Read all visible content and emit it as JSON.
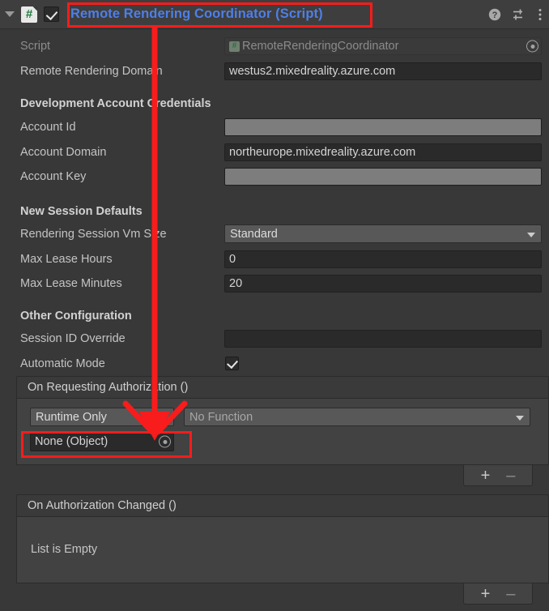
{
  "header": {
    "title": "Remote Rendering Coordinator (Script)",
    "title_color": "#4e7fe8",
    "script_icon": "csharp-script-icon",
    "enabled": true,
    "foldout_expanded": true,
    "icons": [
      {
        "name": "help-icon",
        "glyph": "?"
      },
      {
        "name": "preset-icon",
        "glyph": "sliders"
      },
      {
        "name": "more-menu-icon",
        "glyph": "kebab"
      }
    ]
  },
  "fields": {
    "script": {
      "label": "Script",
      "value": "RemoteRenderingCoordinator",
      "disabled": true,
      "has_object_picker": true
    },
    "remote_rendering_domain": {
      "label": "Remote Rendering Domain",
      "value": "westus2.mixedreality.azure.com"
    }
  },
  "sections": [
    {
      "heading": "Development Account Credentials",
      "rows": [
        {
          "label": "Account Id",
          "value": "",
          "redacted": true
        },
        {
          "label": "Account Domain",
          "value": "northeurope.mixedreality.azure.com",
          "redacted": false
        },
        {
          "label": "Account Key",
          "value": "",
          "redacted": true
        }
      ]
    },
    {
      "heading": "New Session Defaults",
      "rows": [
        {
          "label": "Rendering Session Vm Size",
          "value": "Standard",
          "type": "dropdown"
        },
        {
          "label": "Max Lease Hours",
          "value": "0",
          "type": "text"
        },
        {
          "label": "Max Lease Minutes",
          "value": "20",
          "type": "text"
        }
      ]
    },
    {
      "heading": "Other Configuration",
      "rows": [
        {
          "label": "Session ID Override",
          "value": "",
          "type": "text"
        },
        {
          "label": "Automatic Mode",
          "value": "",
          "type": "checkbox",
          "checked": true
        }
      ]
    }
  ],
  "events": [
    {
      "title": "On Requesting Authorization ()",
      "empty": false,
      "entry": {
        "call_state": "Runtime Only",
        "function": "No Function",
        "target_object": "None (Object)"
      },
      "add_label": "+",
      "remove_label": "–"
    },
    {
      "title": "On Authorization Changed ()",
      "empty": true,
      "empty_text": "List is Empty",
      "add_label": "+",
      "remove_label": "–"
    }
  ],
  "annotations": {
    "color": "#f81c1c",
    "title_highlight": "Remote Rendering Coordinator (Script)",
    "target_highlight": "None (Object)"
  }
}
